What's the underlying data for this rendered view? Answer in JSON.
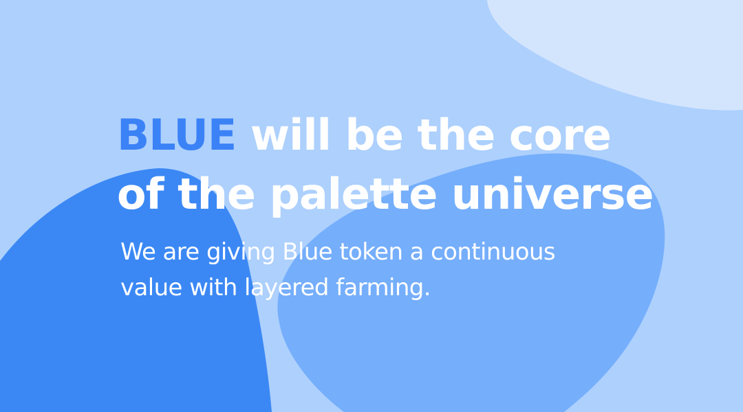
{
  "colors": {
    "background": "#add0fd",
    "blob_top_right": "#d3e5fd",
    "blob_left": "#3b88f5",
    "blob_center": "#75aefb",
    "accent_text": "#3b82f6",
    "body_text": "#ffffff"
  },
  "hero": {
    "headline_accent": "BLUE",
    "headline_line1_rest": " will be the core",
    "headline_line2": "of the palette universe",
    "subtext_line1": "We are giving Blue token a continuous",
    "subtext_line2": "value with layered farming."
  }
}
